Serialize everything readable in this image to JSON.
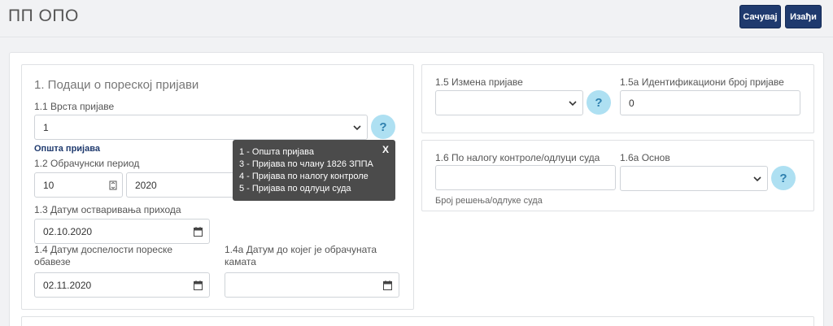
{
  "header": {
    "title": "ПП ОПО",
    "save_label": "Сачувај",
    "exit_label": "Изађи"
  },
  "section1": {
    "title": "1. Подаци о пореској пријави",
    "type_label": "1.1 Врста пријаве",
    "type_value": "1",
    "type_hint": "Општа пријава",
    "period_label": "1.2 Обрачунски период",
    "period_month": "10",
    "period_year": "2020",
    "income_date_label": "1.3 Датум остваривања прихода",
    "income_date": "02.10.2020",
    "due_date_label": "1.4 Датум доспелости пореске обавезе",
    "due_date": "02.11.2020",
    "interest_date_label": "1.4а Датум до којег је обрачуната камата",
    "interest_date": ""
  },
  "tooltip": {
    "close": "X",
    "lines": [
      "1 - Општа пријава",
      "3 - Пријава по члану 1826 ЗППА",
      "4 - Пријава по налогу контроле",
      "5 - Пријава по одлуци суда"
    ]
  },
  "section2": {
    "change_label": "1.5 Измена пријаве",
    "change_value": "",
    "id_label": "1.5а Идентификациони број пријаве",
    "id_value": "0"
  },
  "section3": {
    "order_label": "1.6 По налогу контроле/одлуци суда",
    "order_value": "",
    "order_hint": "Број решења/одлуке суда",
    "basis_label": "1.6а Основ",
    "basis_value": ""
  },
  "help_label": "?",
  "colors": {
    "primary": "#1f3a6e",
    "help_bg": "#aee0f2",
    "tooltip_bg": "#4b4b4b"
  },
  "icons": [
    "calendar-icon",
    "chevron-down-icon",
    "help-icon",
    "close-icon"
  ]
}
